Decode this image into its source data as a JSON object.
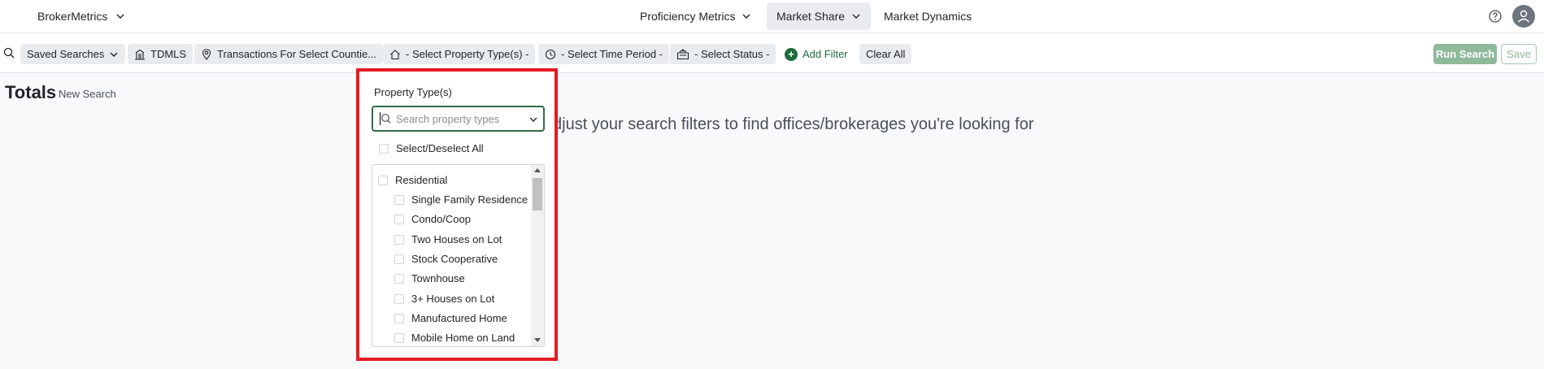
{
  "topnav": {
    "brand": "BrokerMetrics",
    "tabs": [
      {
        "label": "Proficiency Metrics",
        "active": false,
        "has_dropdown": true
      },
      {
        "label": "Market Share",
        "active": true,
        "has_dropdown": true
      },
      {
        "label": "Market Dynamics",
        "active": false,
        "has_dropdown": false
      }
    ],
    "icons": {
      "help": "help-icon",
      "user": "user-avatar-icon"
    }
  },
  "filterbar": {
    "saved_searches": "Saved Searches",
    "mls": "TDMLS",
    "transactions": "Transactions For Select Countie...",
    "property_type": "- Select Property Type(s) -",
    "time_period": "- Select Time Period -",
    "status": "- Select Status -",
    "add_filter": "Add Filter",
    "clear_all": "Clear All",
    "run_search": "Run Search",
    "save": "Save"
  },
  "main": {
    "title": "Totals",
    "new_search": "New Search",
    "message": "djust your search filters to find offices/brokerages you're looking for"
  },
  "property_dropdown": {
    "label": "Property Type(s)",
    "search_placeholder": "Search property types",
    "search_value": "",
    "select_all": "Select/Deselect All",
    "items": [
      {
        "label": "Residential",
        "level": 0,
        "checked": false
      },
      {
        "label": "Single Family Residence",
        "level": 1,
        "checked": false
      },
      {
        "label": "Condo/Coop",
        "level": 1,
        "checked": false
      },
      {
        "label": "Two Houses on Lot",
        "level": 1,
        "checked": false
      },
      {
        "label": "Stock Cooperative",
        "level": 1,
        "checked": false
      },
      {
        "label": "Townhouse",
        "level": 1,
        "checked": false
      },
      {
        "label": "3+ Houses on Lot",
        "level": 1,
        "checked": false
      },
      {
        "label": "Manufactured Home",
        "level": 1,
        "checked": false
      },
      {
        "label": "Mobile Home on Land",
        "level": 1,
        "checked": false
      }
    ]
  },
  "colors": {
    "accent_green": "#1e6b3a",
    "highlight_red": "#e31b23",
    "run_button": "#8fb99a",
    "chip_bg": "#e9ecef"
  }
}
